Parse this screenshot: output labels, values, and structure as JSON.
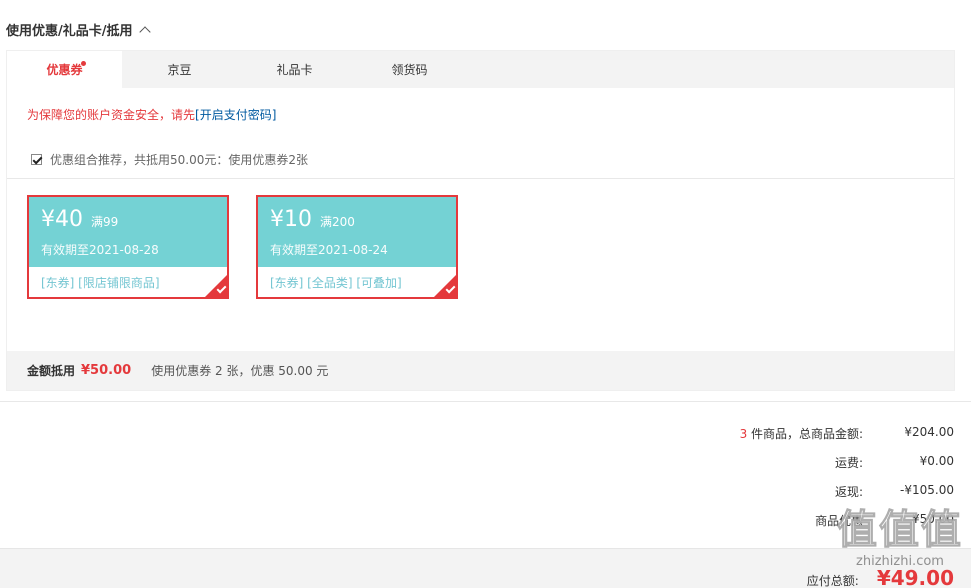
{
  "section": {
    "title": "使用优惠/礼品卡/抵用"
  },
  "tabs": [
    {
      "label": "优惠券",
      "active": true
    },
    {
      "label": "京豆"
    },
    {
      "label": "礼品卡"
    },
    {
      "label": "领货码"
    }
  ],
  "warning": {
    "text": "为保障您的账户资金安全，请先",
    "link": "[开启支付密码]"
  },
  "recommend": {
    "text": "优惠组合推荐，共抵用50.00元：使用优惠券2张",
    "checked": true
  },
  "coupons": [
    {
      "symbol": "¥40",
      "condition": "满99",
      "valid": "有效期至2021-08-28",
      "tags": "[东券]  [限店铺限商品]",
      "selected": true
    },
    {
      "symbol": "¥10",
      "condition": "满200",
      "valid": "有效期至2021-08-24",
      "tags": "[东券]  [全品类]  [可叠加]",
      "selected": true
    }
  ],
  "summary": {
    "label": "金额抵用",
    "amount": "¥50.00",
    "desc": "使用优惠券 2 张，优惠 50.00 元"
  },
  "totals": {
    "items_count": "3",
    "items_label": " 件商品，总商品金额:",
    "items_value": "¥204.00",
    "shipping_label": "运费:",
    "shipping_value": "¥0.00",
    "cashback_label": "返现:",
    "cashback_value": "-¥105.00",
    "discount_label": "商品优惠",
    "discount_value": "¥50.00"
  },
  "payable": {
    "label": "应付总额:",
    "value": "¥49.00"
  },
  "watermark": {
    "big": "值值值",
    "small": "zhizhizhi.com"
  },
  "colors": {
    "accent": "#e4393c",
    "coupon": "#74d2d4",
    "link": "#005aa0"
  }
}
